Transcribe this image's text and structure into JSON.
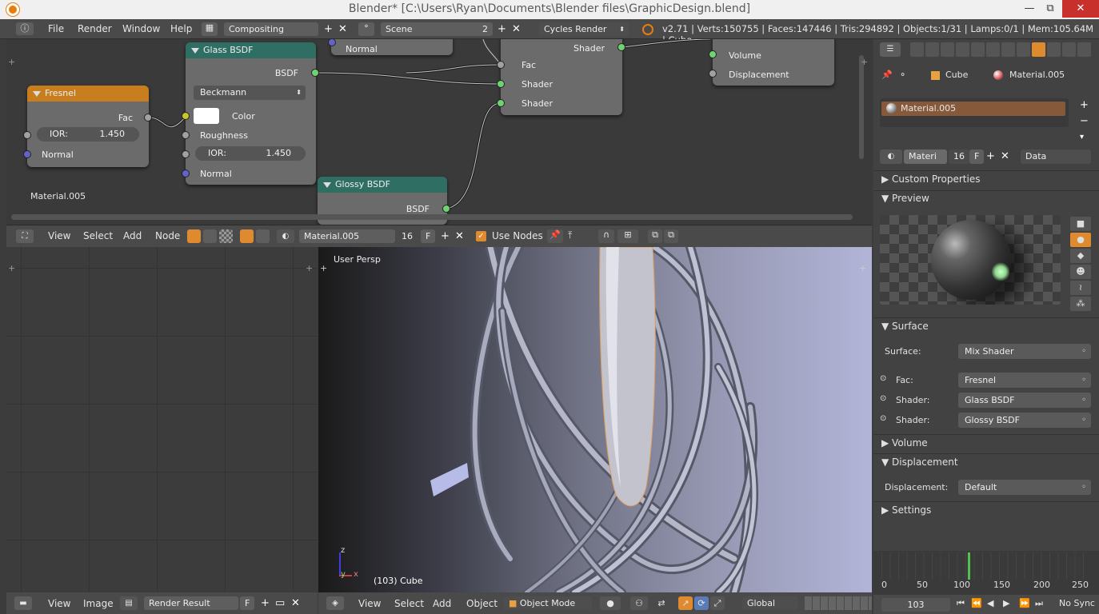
{
  "window": {
    "title": "Blender* [C:\\Users\\Ryan\\Documents\\Blender files\\GraphicDesign.blend]",
    "min": "—",
    "max": "⧉",
    "close": "✕"
  },
  "topbar": {
    "menus": [
      "File",
      "Render",
      "Window",
      "Help"
    ],
    "layout": "Compositing",
    "scene": "Scene",
    "scene_users": "2",
    "engine": "Cycles Render",
    "stats": "v2.71 | Verts:150755 | Faces:147446 | Tris:294892 | Objects:1/31 | Lamps:0/1 | Mem:105.64M | Cube"
  },
  "nodes": {
    "fresnel": {
      "title": "Fresnel",
      "out_fac": "Fac",
      "ior_label": "IOR:",
      "ior": "1.450",
      "normal": "Normal"
    },
    "glass": {
      "title": "Glass BSDF",
      "out": "BSDF",
      "dist": "Beckmann",
      "color": "Color",
      "roughness": "Roughness",
      "ior_label": "IOR:",
      "ior": "1.450",
      "normal": "Normal"
    },
    "top": {
      "normal": "Normal"
    },
    "mix": {
      "out": "Shader",
      "fac": "Fac",
      "shader1": "Shader",
      "shader2": "Shader"
    },
    "output": {
      "volume": "Volume",
      "displacement": "Displacement"
    },
    "glossy": {
      "title": "Glossy BSDF",
      "out": "BSDF"
    },
    "material_label": "Material.005"
  },
  "node_header": {
    "view": "View",
    "select": "Select",
    "add": "Add",
    "node": "Node",
    "material": "Material.005",
    "users": "16",
    "fake": "F",
    "use_nodes": "Use Nodes"
  },
  "image_header": {
    "view": "View",
    "image": "Image",
    "image_name": "Render Result",
    "fake": "F"
  },
  "viewport": {
    "label": "User Persp",
    "object_label": "(103) Cube",
    "axis_z": "z",
    "axis_y": "y",
    "axis_x": "x"
  },
  "v3d_header": {
    "view": "View",
    "select": "Select",
    "add": "Add",
    "object": "Object",
    "mode": "Object Mode",
    "orientation": "Global"
  },
  "props": {
    "object": "Cube",
    "material": "Material.005",
    "slot": "Material.005",
    "mat_short": "Materi",
    "mat_users": "16",
    "fake": "F",
    "link": "Data",
    "custom_properties": "Custom Properties",
    "preview": "Preview",
    "surface": "Surface",
    "surface_label": "Surface:",
    "surface_value": "Mix Shader",
    "fac_label": "Fac:",
    "fac_value": "Fresnel",
    "shader1_label": "Shader:",
    "shader1_value": "Glass BSDF",
    "shader2_label": "Shader:",
    "shader2_value": "Glossy BSDF",
    "volume": "Volume",
    "displacement": "Displacement",
    "disp_label": "Displacement:",
    "disp_value": "Default",
    "settings": "Settings"
  },
  "timeline": {
    "ticks": [
      "0",
      "50",
      "100",
      "150",
      "200",
      "250"
    ],
    "current_frame": "103",
    "frame_fraction": 0.412,
    "sync": "No Sync"
  },
  "colors": {
    "fresnel_header": "#c87d1e",
    "shader_header": "#2e6e63",
    "socket_shader": "#6fd46f",
    "socket_gray": "#a1a1a1",
    "socket_yellow": "#c7c729",
    "socket_blue": "#6363c7"
  }
}
